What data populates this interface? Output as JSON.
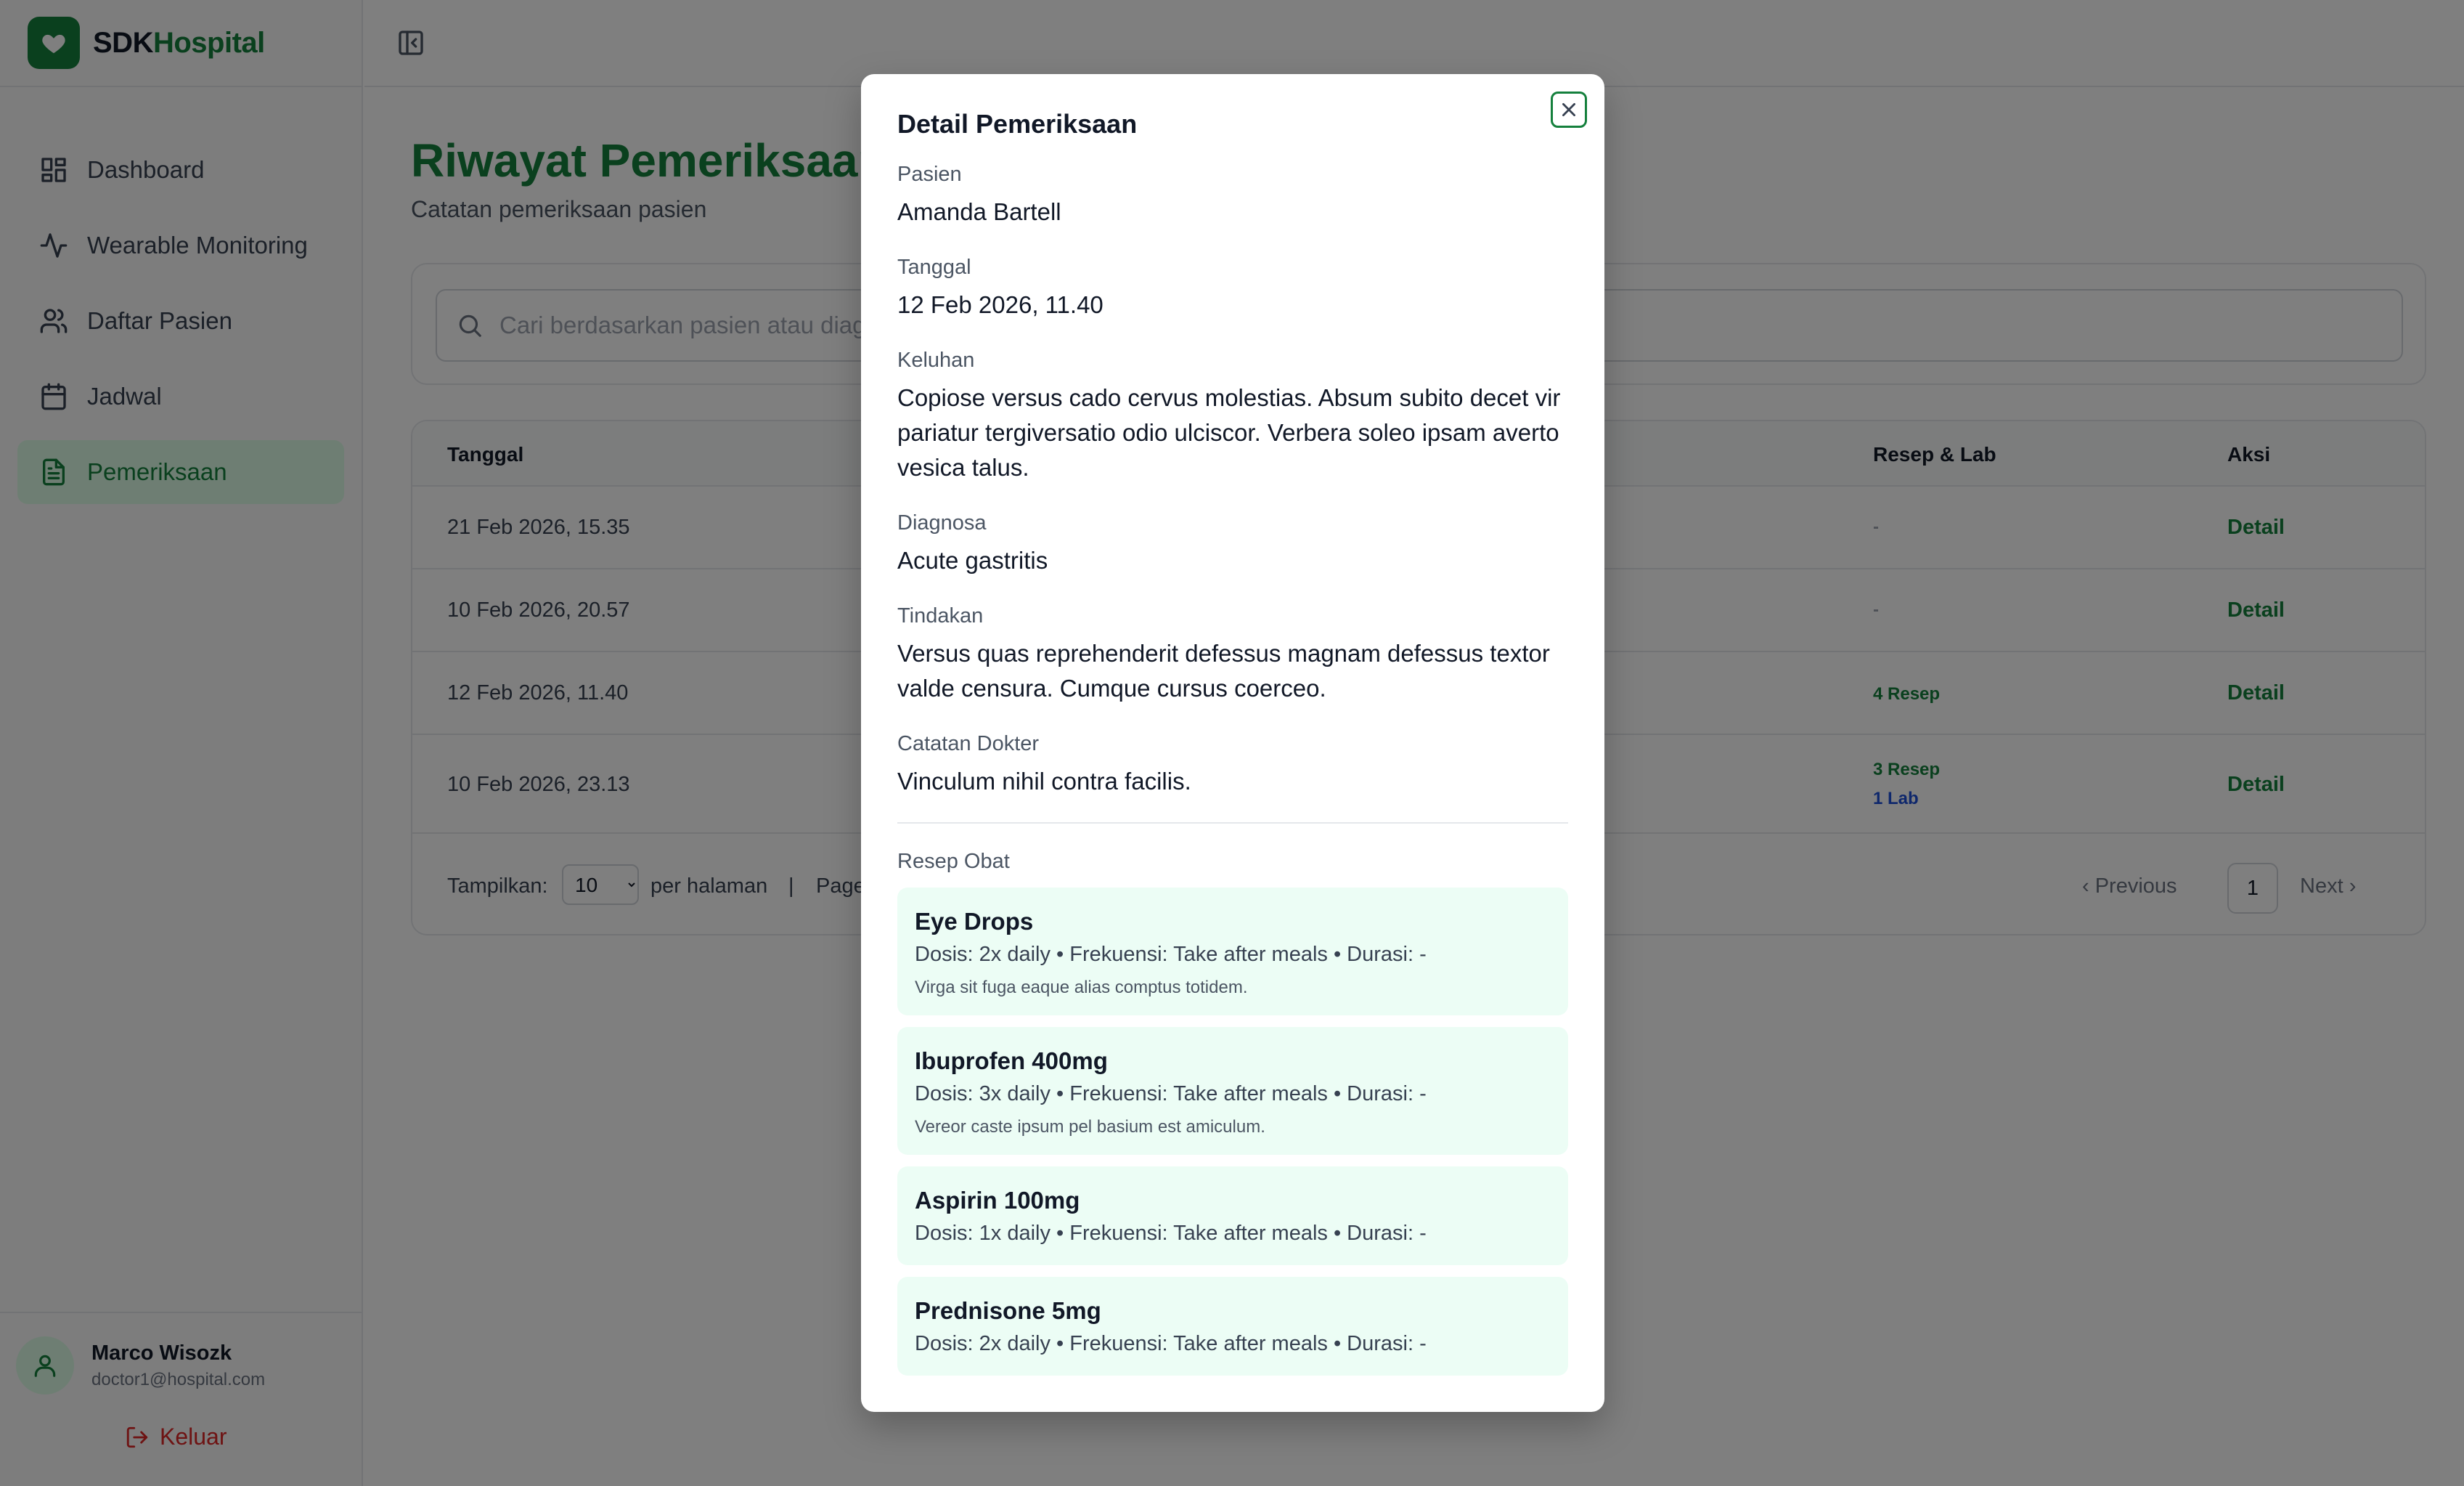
{
  "brand": {
    "part1": "SDK",
    "part2": "Hospital"
  },
  "sidebar": {
    "items": [
      {
        "label": "Dashboard"
      },
      {
        "label": "Wearable Monitoring"
      },
      {
        "label": "Daftar Pasien"
      },
      {
        "label": "Jadwal"
      },
      {
        "label": "Pemeriksaan"
      }
    ],
    "active_item": "Pemeriksaan",
    "user": {
      "name": "Marco Wisozk",
      "email": "doctor1@hospital.com"
    },
    "logout_label": "Keluar"
  },
  "page": {
    "title": "Riwayat Pemeriksaan",
    "subtitle": "Catatan pemeriksaan pasien",
    "search_placeholder": "Cari berdasarkan pasien atau diagnosa..."
  },
  "table": {
    "headers": {
      "date": "Tanggal",
      "rx_lab": "Resep & Lab",
      "action": "Aksi"
    },
    "rows": [
      {
        "date": "21 Feb 2026, 15.35",
        "rx": "-",
        "lab": "",
        "action": "Detail"
      },
      {
        "date": "10 Feb 2026, 20.57",
        "rx": "-",
        "lab": "",
        "action": "Detail"
      },
      {
        "date": "12 Feb 2026, 11.40",
        "rx": "4 Resep",
        "lab": "",
        "action": "Detail"
      },
      {
        "date": "10 Feb 2026, 23.13",
        "rx": "3 Resep",
        "lab": "1 Lab",
        "action": "Detail"
      }
    ],
    "pagination": {
      "show_label": "Tampilkan:",
      "page_size": "10",
      "per_page_label": "per halaman",
      "separator": "|",
      "page_label": "Page",
      "previous": "Previous",
      "current_page": "1",
      "next": "Next"
    }
  },
  "modal": {
    "title": "Detail Pemeriksaan",
    "fields": {
      "patient": {
        "label": "Pasien",
        "value": "Amanda Bartell"
      },
      "date": {
        "label": "Tanggal",
        "value": "12 Feb 2026, 11.40"
      },
      "complaint": {
        "label": "Keluhan",
        "value": "Copiose versus cado cervus molestias. Absum subito decet vir pariatur tergiversatio odio ulciscor. Verbera soleo ipsam averto vesica talus."
      },
      "diagnosis": {
        "label": "Diagnosa",
        "value": "Acute gastritis"
      },
      "action": {
        "label": "Tindakan",
        "value": "Versus quas reprehenderit defessus magnam defessus textor valde censura. Cumque cursus coerceo."
      },
      "notes": {
        "label": "Catatan Dokter",
        "value": "Vinculum nihil contra facilis."
      }
    },
    "prescriptions_label": "Resep Obat",
    "prescriptions": [
      {
        "name": "Eye Drops",
        "meta": "Dosis: 2x daily • Frekuensi: Take after meals • Durasi: -",
        "note": "Virga sit fuga eaque alias comptus totidem."
      },
      {
        "name": "Ibuprofen 400mg",
        "meta": "Dosis: 3x daily • Frekuensi: Take after meals • Durasi: -",
        "note": "Vereor caste ipsum pel basium est amiculum."
      },
      {
        "name": "Aspirin 100mg",
        "meta": "Dosis: 1x daily • Frekuensi: Take after meals • Durasi: -",
        "note": ""
      },
      {
        "name": "Prednisone 5mg",
        "meta": "Dosis: 2x daily • Frekuensi: Take after meals • Durasi: -",
        "note": ""
      }
    ]
  }
}
